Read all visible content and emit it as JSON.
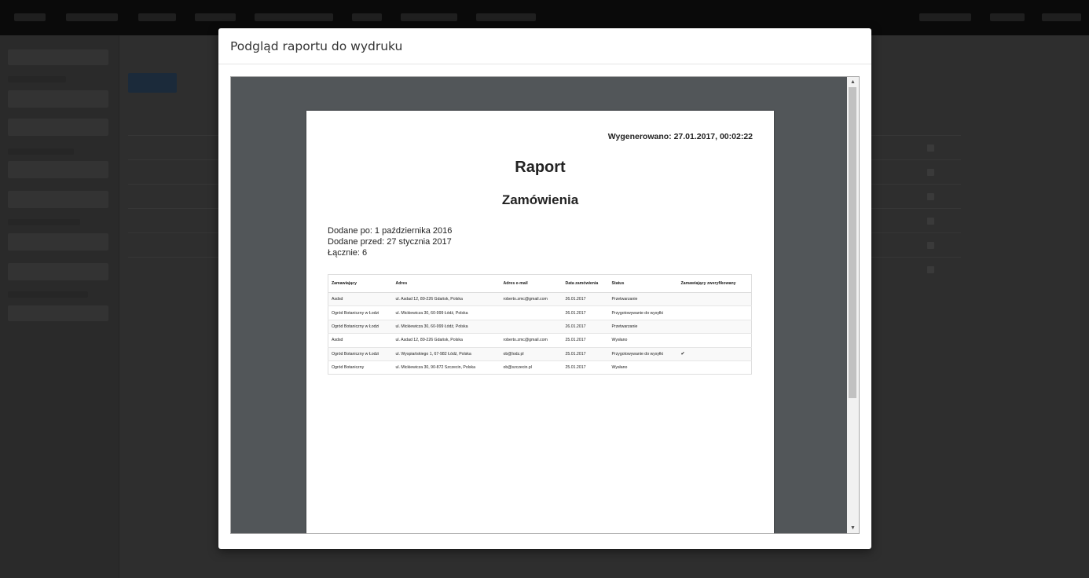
{
  "modal": {
    "title": "Podgląd raportu do wydruku"
  },
  "report": {
    "generated": "Wygenerowano: 27.01.2017, 00:02:22",
    "title": "Raport",
    "subtitle": "Zamówienia",
    "added_after": "Dodane po: 1 października 2016",
    "added_before": "Dodane przed: 27 stycznia 2017",
    "total": "Łącznie: 6",
    "columns": [
      "Zamawiający",
      "Adres",
      "Adres e-mail",
      "Data zamówienia",
      "Status",
      "Zamawiający zweryfikowany"
    ],
    "rows": [
      {
        "client": "Asdsd",
        "address": "ul. Asdad 12, 89-226 Gdańsk, Polska",
        "email": "roberto.zmc@gmail.com",
        "date": "26.01.2017",
        "status": "Przetwarzanie",
        "verified": ""
      },
      {
        "client": "Ogród Botaniczny w Łodzi",
        "address": "ul. Mickiewicza 30, 60-999 Łódź, Polska",
        "email": "",
        "date": "26.01.2017",
        "status": "Przygotowywanie do wysyłki",
        "verified": ""
      },
      {
        "client": "Ogród Botaniczny w Łodzi",
        "address": "ul. Mickiewicza 30, 60-999 Łódź, Polska",
        "email": "",
        "date": "26.01.2017",
        "status": "Przetwarzanie",
        "verified": ""
      },
      {
        "client": "Asdsd",
        "address": "ul. Asdad 12, 89-226 Gdańsk, Polska",
        "email": "roberto.zmc@gmail.com",
        "date": "25.01.2017",
        "status": "Wysłano",
        "verified": ""
      },
      {
        "client": "Ogród Botaniczny w Łodzi",
        "address": "ul. Wyspiańskiego 1, 67-982 Łódź, Polska",
        "email": "ob@lodz.pl",
        "date": "25.01.2017",
        "status": "Przygotowywanie do wysyłki",
        "verified": "✔"
      },
      {
        "client": "Ogród Botaniczny",
        "address": "ul. Mickiewicza 30, 90-872 Szczecin, Polska",
        "email": "ob@szczecin.pl",
        "date": "25.01.2017",
        "status": "Wysłano",
        "verified": ""
      }
    ]
  },
  "scrollbar": {
    "up_icon": "▲",
    "down_icon": "▼"
  }
}
